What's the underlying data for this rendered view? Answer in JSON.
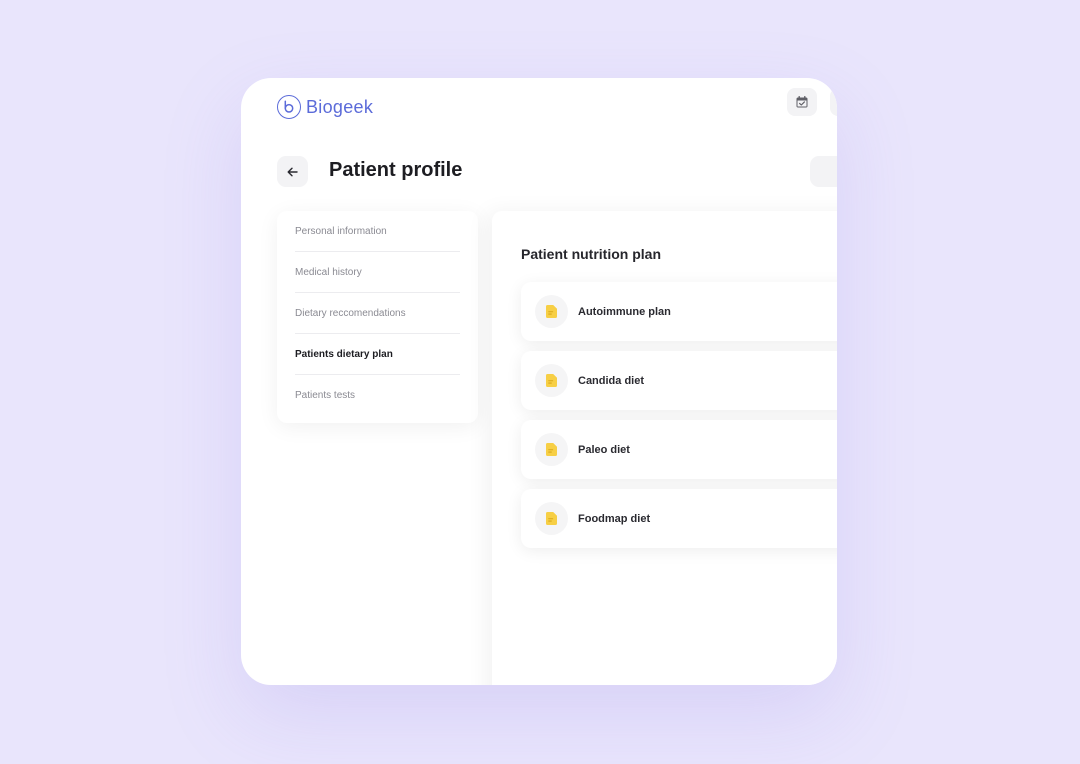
{
  "app": {
    "brand_name": "Biogeek",
    "brand_color": "#5b6bd9",
    "background_color": "#e9e5fc"
  },
  "header": {
    "icons": [
      "calendar-icon",
      "unknown-icon"
    ]
  },
  "page": {
    "title": "Patient profile",
    "back_icon": "arrow-left-icon"
  },
  "sidebar": {
    "items": [
      {
        "label": "Personal information",
        "active": false
      },
      {
        "label": "Medical history",
        "active": false
      },
      {
        "label": "Dietary reccomendations",
        "active": false
      },
      {
        "label": "Patients dietary plan",
        "active": true
      },
      {
        "label": "Patients tests",
        "active": false
      }
    ]
  },
  "main": {
    "title": "Patient nutrition plan",
    "plans": [
      {
        "label": "Autoimmune plan",
        "icon": "document-icon"
      },
      {
        "label": "Candida diet",
        "icon": "document-icon"
      },
      {
        "label": "Paleo diet",
        "icon": "document-icon"
      },
      {
        "label": "Foodmap diet",
        "icon": "document-icon"
      }
    ],
    "plan_icon_color": "#f7cf45"
  }
}
